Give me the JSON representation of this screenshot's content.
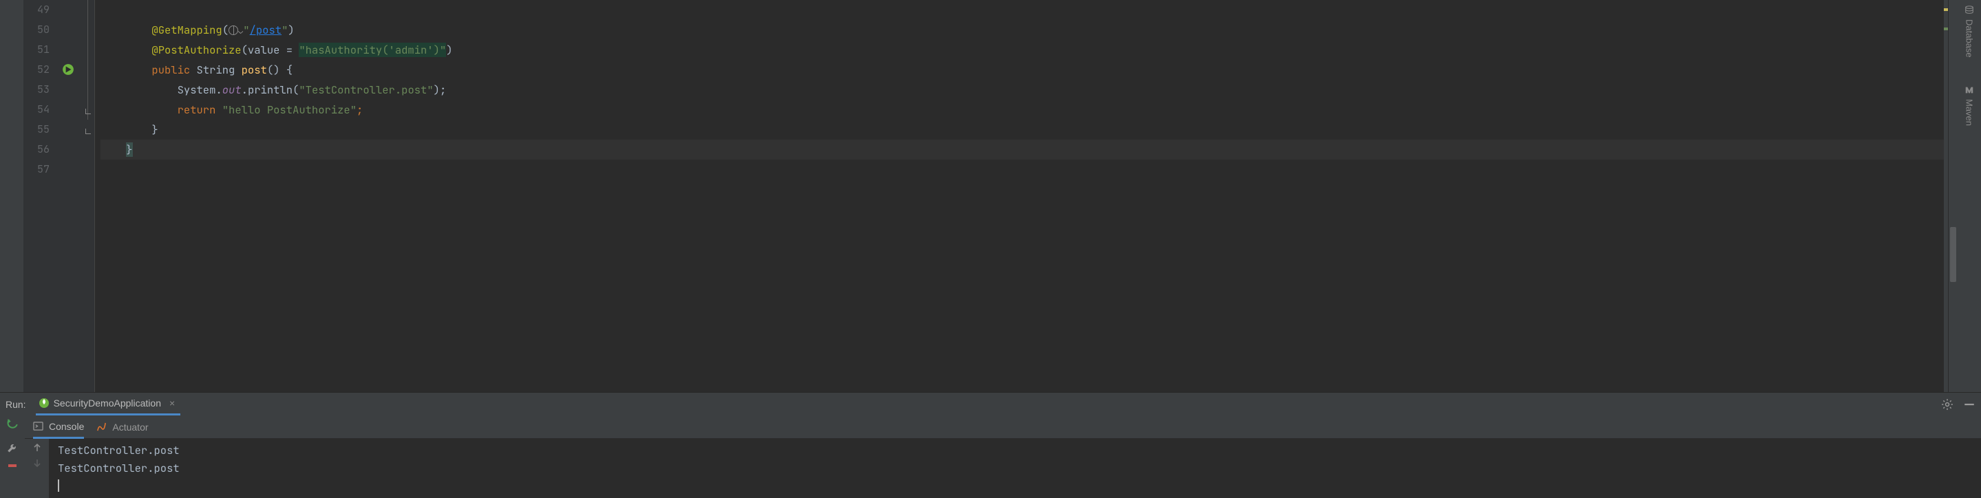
{
  "editor": {
    "lines": [
      "49",
      "50",
      "51",
      "52",
      "53",
      "54",
      "55",
      "56",
      "57"
    ],
    "code": {
      "l50": {
        "ann": "@GetMapping",
        "lp": "(",
        "url": "/post",
        "q1": "\"",
        "q2": "\"",
        "rp": ")"
      },
      "l51": {
        "ann": "@PostAuthorize",
        "lp": "(",
        "param": "value = ",
        "str": "\"hasAuthority('admin')\"",
        "rp": ")"
      },
      "l52": {
        "kw": "public ",
        "type": "String ",
        "method": "post",
        "sig": "() {"
      },
      "l53": {
        "obj": "System.",
        "field": "out",
        "dot": ".",
        "call": "println(",
        "str": "\"TestController.post\"",
        "end": ");"
      },
      "l54": {
        "kw": "return ",
        "str": "\"hello PostAuthorize\"",
        "semi": ";"
      },
      "l55": {
        "brace": "}"
      },
      "l56": {
        "brace": "}"
      }
    }
  },
  "rightTools": {
    "database": "Database",
    "maven": "Maven"
  },
  "runPanel": {
    "label": "Run:",
    "config": "SecurityDemoApplication",
    "tabs": {
      "console": "Console",
      "actuator": "Actuator"
    },
    "output": [
      "TestController.post",
      "TestController.post"
    ]
  }
}
